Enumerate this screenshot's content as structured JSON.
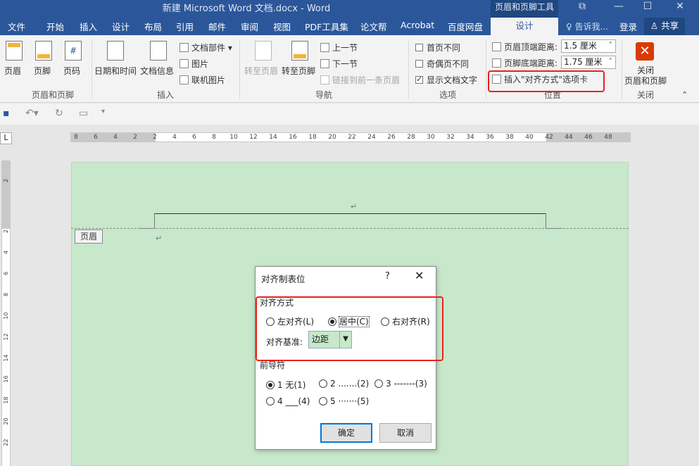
{
  "window": {
    "title": "新建 Microsoft Word 文档.docx - Word",
    "context_tools": "页眉和页脚工具"
  },
  "tabs": [
    "文件",
    "开始",
    "插入",
    "设计",
    "布局",
    "引用",
    "邮件",
    "审阅",
    "视图",
    "PDF工具集",
    "论文帮",
    "Acrobat",
    "百度网盘"
  ],
  "active_tab": "设计",
  "tell_me": "告诉我...",
  "login": "登录",
  "share": "共享",
  "ribbon": {
    "hf": {
      "header": "页眉",
      "footer": "页脚",
      "page_number": "页码",
      "label": "页眉和页脚"
    },
    "insert": {
      "datetime": "日期和时间",
      "docinfo": "文档信息",
      "quickparts": "文档部件",
      "picture": "图片",
      "online_picture": "联机图片",
      "label": "插入"
    },
    "nav": {
      "goto_header": "转至页眉",
      "goto_footer": "转至页脚",
      "prev": "上一节",
      "next": "下一节",
      "link_prev": "链接到前一条页眉",
      "label": "导航"
    },
    "options": {
      "first_page": "首页不同",
      "odd_even": "奇偶页不同",
      "show_text": "显示文档文字",
      "label": "选项"
    },
    "position": {
      "header_top": "页眉顶端距离:",
      "header_top_value": "1.5 厘米",
      "footer_bottom": "页脚底端距离:",
      "footer_bottom_value": "1.75 厘米",
      "insert_align_tab": "插入\"对齐方式\"选项卡",
      "label": "位置"
    },
    "close": {
      "label1": "关闭",
      "label2": "页眉和页脚",
      "group": "关闭"
    }
  },
  "ruler_ticks": [
    "8",
    "6",
    "4",
    "2",
    "2",
    "4",
    "6",
    "8",
    "10",
    "12",
    "14",
    "16",
    "18",
    "20",
    "22",
    "24",
    "26",
    "28",
    "30",
    "32",
    "34",
    "36",
    "38",
    "40",
    "42",
    "44",
    "46",
    "48"
  ],
  "vruler_ticks": [
    "2",
    "2",
    "4",
    "6",
    "8",
    "10",
    "12",
    "14",
    "16",
    "18",
    "20",
    "22"
  ],
  "document": {
    "header_tag": "页眉",
    "para_mark": "↵"
  },
  "dialog": {
    "title": "对齐制表位",
    "help": "?",
    "close": "✕",
    "alignment_label": "对齐方式",
    "align_left": "左对齐(L)",
    "align_center": "居中(C)",
    "align_right": "右对齐(R)",
    "align_base_label": "对齐基准:",
    "align_base_value": "边距",
    "leader_label": "前导符",
    "leaders": [
      "1 无(1)",
      "2 .......(2)",
      "3 -------(3)",
      "4 ___(4)",
      "5 ·······(5)"
    ],
    "ok": "确定",
    "cancel": "取消"
  }
}
